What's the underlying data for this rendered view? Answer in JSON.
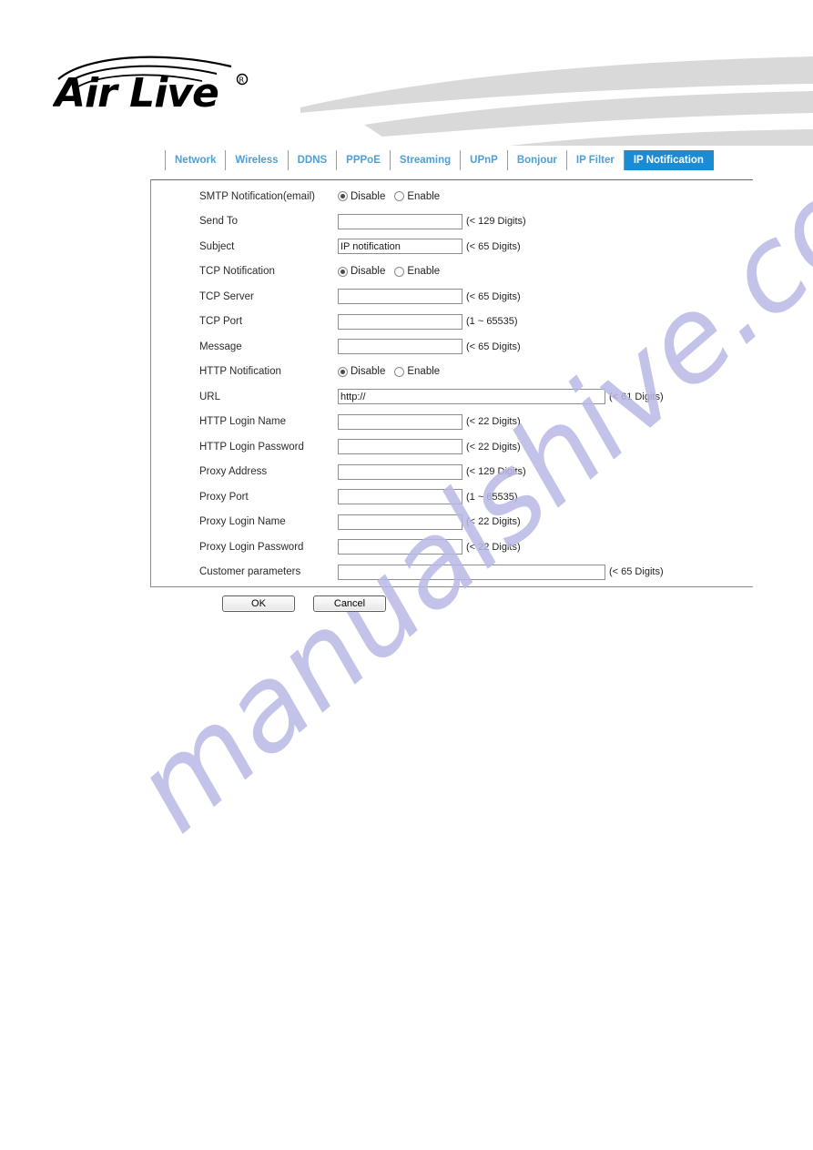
{
  "brand": {
    "logo_text": "Air Live",
    "logo_trademark": "®",
    "logo_icon": "wifi-waves-icon"
  },
  "tabs": [
    {
      "label": "Network",
      "active": false
    },
    {
      "label": "Wireless",
      "active": false
    },
    {
      "label": "DDNS",
      "active": false
    },
    {
      "label": "PPPoE",
      "active": false
    },
    {
      "label": "Streaming",
      "active": false
    },
    {
      "label": "UPnP",
      "active": false
    },
    {
      "label": "Bonjour",
      "active": false
    },
    {
      "label": "IP Filter",
      "active": false
    },
    {
      "label": "IP Notification",
      "active": true
    }
  ],
  "radio_options": {
    "disable": "Disable",
    "enable": "Enable"
  },
  "form": {
    "rows": [
      {
        "label": "SMTP Notification(email)",
        "type": "radio",
        "selected": "disable"
      },
      {
        "label": "Send To",
        "type": "text",
        "value": "",
        "width": "std",
        "hint": "(< 129 Digits)"
      },
      {
        "label": "Subject",
        "type": "text",
        "value": "IP notification",
        "width": "std",
        "hint": "(< 65 Digits)"
      },
      {
        "label": "TCP Notification",
        "type": "radio",
        "selected": "disable"
      },
      {
        "label": "TCP Server",
        "type": "text",
        "value": "",
        "width": "std",
        "hint": "(< 65 Digits)"
      },
      {
        "label": "TCP Port",
        "type": "text",
        "value": "",
        "width": "std",
        "hint": "(1 ~ 65535)"
      },
      {
        "label": "Message",
        "type": "text",
        "value": "",
        "width": "std",
        "hint": "(< 65 Digits)"
      },
      {
        "label": "HTTP Notification",
        "type": "radio",
        "selected": "disable"
      },
      {
        "label": "URL",
        "type": "text",
        "value": "http://",
        "width": "wide",
        "hint": "(< 61 Digits)"
      },
      {
        "label": "HTTP Login Name",
        "type": "text",
        "value": "",
        "width": "std",
        "hint": "(< 22 Digits)"
      },
      {
        "label": "HTTP Login Password",
        "type": "text",
        "value": "",
        "width": "std",
        "hint": "(< 22 Digits)"
      },
      {
        "label": "Proxy Address",
        "type": "text",
        "value": "",
        "width": "std",
        "hint": "(< 129 Digits)"
      },
      {
        "label": "Proxy Port",
        "type": "text",
        "value": "",
        "width": "std",
        "hint": "(1 ~ 65535)"
      },
      {
        "label": "Proxy Login Name",
        "type": "text",
        "value": "",
        "width": "std",
        "hint": "(< 22 Digits)"
      },
      {
        "label": "Proxy Login Password",
        "type": "text",
        "value": "",
        "width": "std",
        "hint": "(< 22 Digits)"
      },
      {
        "label": "Customer parameters",
        "type": "text",
        "value": "",
        "width": "wide",
        "hint": "(< 65 Digits)"
      },
      {
        "label": "Message",
        "type": "text",
        "value": "",
        "width": "wide",
        "hint": "(< 65 Digits)"
      }
    ]
  },
  "actions": {
    "ok_label": "OK",
    "cancel_label": "Cancel"
  },
  "watermark": {
    "text": "manualshive.com"
  },
  "colors": {
    "accent_blue": "#1b8cd4",
    "tab_text_blue": "#4d9fd4",
    "header_swoosh_gray": "#d9d9d9",
    "watermark": "#b9b9e6"
  }
}
